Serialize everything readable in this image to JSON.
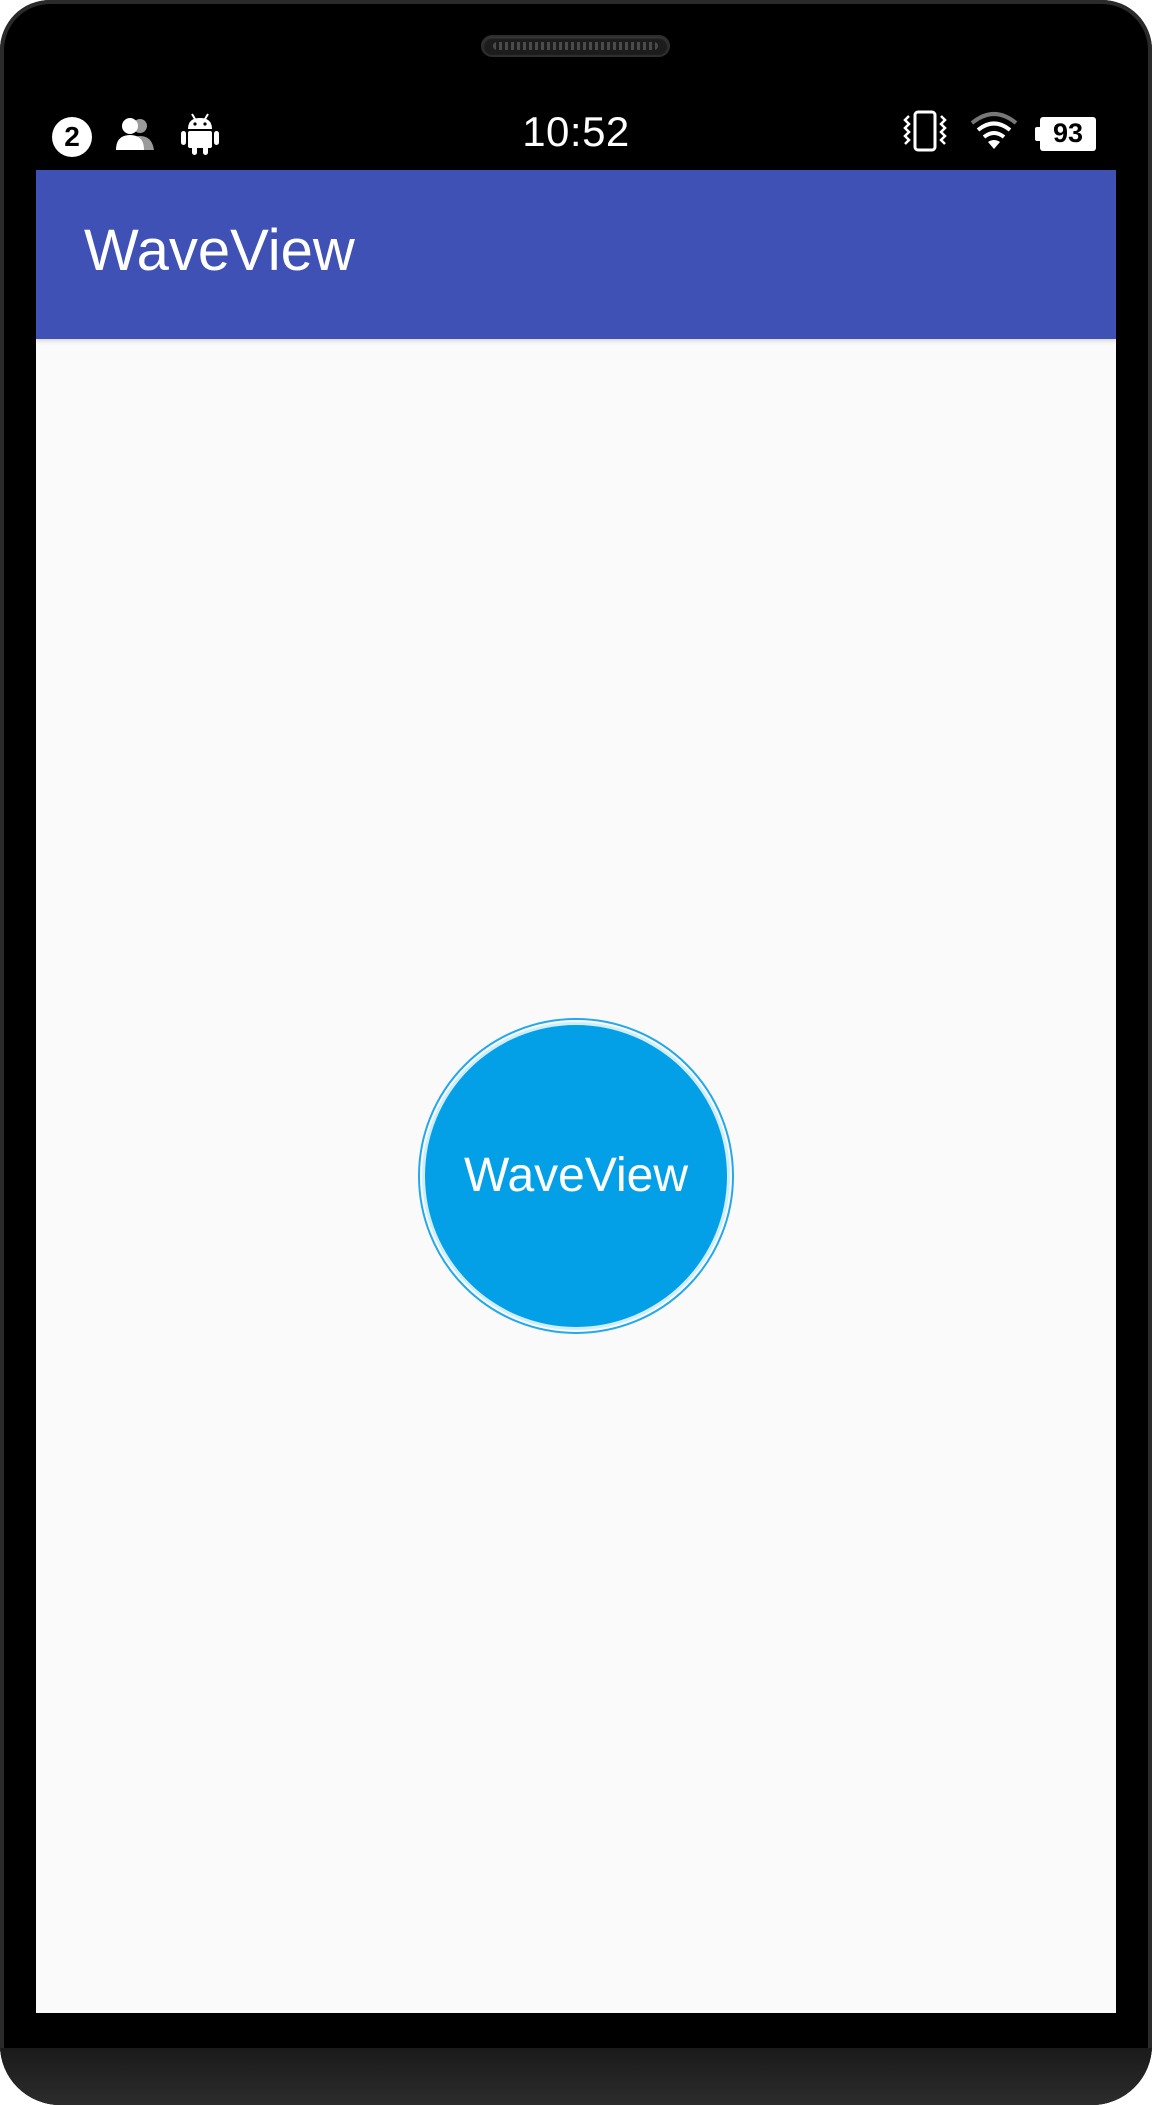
{
  "status_bar": {
    "notification_count": "2",
    "time": "10:52",
    "battery_level": "93",
    "left_icons": [
      "notification-count-badge",
      "people-icon",
      "android-icon"
    ],
    "right_icons": [
      "vibrate-icon",
      "wifi-icon",
      "battery-icon"
    ]
  },
  "app_bar": {
    "title": "WaveView",
    "color": "#3f51b5"
  },
  "wave_view": {
    "label": "WaveView",
    "fill_color": "#03a0e8",
    "ring_color": "#24a8ee"
  },
  "screen": {
    "background": "#fafafa"
  }
}
